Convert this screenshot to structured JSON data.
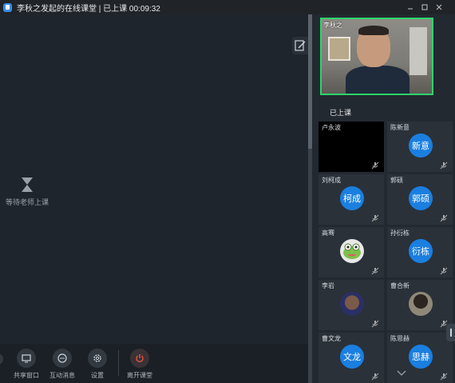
{
  "window": {
    "title": "李秋之发起的在线课堂 | 已上课 00:09:32"
  },
  "stage": {
    "waiting_text": "等待老师上课"
  },
  "toolbar": [
    {
      "label": "共享窗口",
      "icon": "share-window-icon"
    },
    {
      "label": "互动消息",
      "icon": "chat-bubble-icon"
    },
    {
      "label": "设置",
      "icon": "gear-icon"
    },
    {
      "label": "离开课堂",
      "icon": "power-icon"
    }
  ],
  "teacher": {
    "name": "李秋之"
  },
  "class_status": "已上课",
  "students": [
    {
      "name": "卢永波",
      "avatar_text": "",
      "avatar": "black-video"
    },
    {
      "name": "陈新意",
      "avatar_text": "新意",
      "avatar": "initials"
    },
    {
      "name": "刘柯成",
      "avatar_text": "柯成",
      "avatar": "initials"
    },
    {
      "name": "郭硕",
      "avatar_text": "郭硕",
      "avatar": "initials"
    },
    {
      "name": "高骞",
      "avatar_text": "",
      "avatar": "frog-image"
    },
    {
      "name": "孙衍栋",
      "avatar_text": "衍栋",
      "avatar": "initials"
    },
    {
      "name": "李岩",
      "avatar_text": "",
      "avatar": "photo"
    },
    {
      "name": "曹合新",
      "avatar_text": "",
      "avatar": "photo"
    },
    {
      "name": "曹文龙",
      "avatar_text": "文龙",
      "avatar": "initials"
    },
    {
      "name": "陈思赫",
      "avatar_text": "思赫",
      "avatar": "initials"
    }
  ],
  "colors": {
    "accent_blue": "#1a7fe0",
    "active_border": "#2fd36b"
  }
}
